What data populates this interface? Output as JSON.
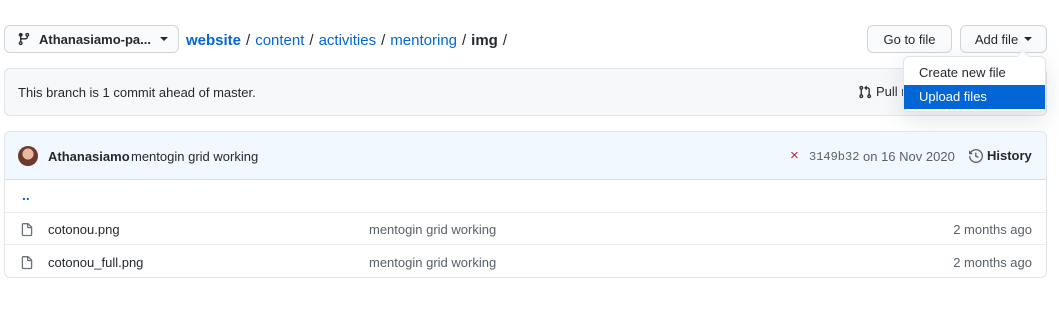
{
  "branch": {
    "name": "Athanasiamo-pa...",
    "icon": "git-branch-icon"
  },
  "breadcrumb": {
    "root": "website",
    "parts": [
      "content",
      "activities",
      "mentoring"
    ],
    "current": "img",
    "separator": "/"
  },
  "buttons": {
    "go_to_file": "Go to file",
    "add_file": "Add file"
  },
  "ahead_bar": {
    "text": "This branch is 1 commit ahead of master.",
    "pull_request": "Pull r"
  },
  "dropdown": {
    "items": [
      "Create new file",
      "Upload files"
    ],
    "active_index": 1
  },
  "commit": {
    "author": "Athanasiamo",
    "message": "mentogin grid working",
    "status_icon": "×",
    "sha": "3149b32",
    "date": "on 16 Nov 2020",
    "history": "History"
  },
  "parent_link": "..",
  "files": [
    {
      "name": "cotonou.png",
      "message": "mentogin grid working",
      "age": "2 months ago"
    },
    {
      "name": "cotonou_full.png",
      "message": "mentogin grid working",
      "age": "2 months ago"
    }
  ],
  "colors": {
    "link": "#0366d6",
    "active": "#0366d6",
    "fail": "#cb2431",
    "commit_bg": "#f1f8ff"
  }
}
